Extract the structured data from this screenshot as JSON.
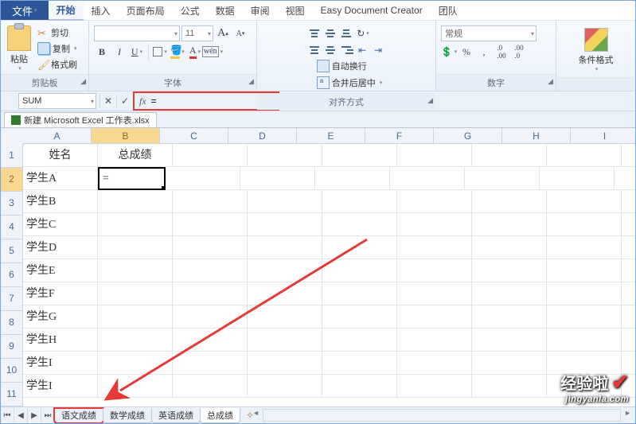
{
  "menu": {
    "file": "文件",
    "items": [
      "开始",
      "插入",
      "页面布局",
      "公式",
      "数据",
      "审阅",
      "视图",
      "Easy Document Creator",
      "团队"
    ],
    "active_index": 0
  },
  "ribbon": {
    "clipboard": {
      "label": "剪贴板",
      "paste": "粘贴",
      "cut": "剪切",
      "copy": "复制",
      "format_painter": "格式刷"
    },
    "font": {
      "label": "字体",
      "font_name_placeholder": "",
      "size": "11",
      "bold": "B",
      "italic": "I",
      "underline": "U",
      "phonetic": "wén"
    },
    "alignment": {
      "label": "对齐方式",
      "wrap": "自动换行",
      "merge": "合并后居中"
    },
    "number": {
      "label": "数字",
      "format": "常规",
      "currency": "¥",
      "percent": "%",
      "comma": ",",
      "dec_inc": ".00→.0",
      "dec_dec": ".0→.00"
    },
    "cond_format": "条件格式"
  },
  "formula_bar": {
    "name_box": "SUM",
    "cancel": "✕",
    "enter": "✓",
    "fx": "fx",
    "formula": "="
  },
  "workbook_tab": "新建 Microsoft Excel 工作表.xlsx",
  "grid": {
    "columns": [
      "A",
      "B",
      "C",
      "D",
      "E",
      "F",
      "G",
      "H",
      "I"
    ],
    "active_col_index": 1,
    "active_row_index": 1,
    "rows": [
      {
        "n": "1",
        "cells": [
          "姓名",
          "总成绩",
          "",
          "",
          "",
          "",
          "",
          "",
          ""
        ]
      },
      {
        "n": "2",
        "cells": [
          "学生A",
          "=",
          "",
          "",
          "",
          "",
          "",
          "",
          ""
        ]
      },
      {
        "n": "3",
        "cells": [
          "学生B",
          "",
          "",
          "",
          "",
          "",
          "",
          "",
          ""
        ]
      },
      {
        "n": "4",
        "cells": [
          "学生C",
          "",
          "",
          "",
          "",
          "",
          "",
          "",
          ""
        ]
      },
      {
        "n": "5",
        "cells": [
          "学生D",
          "",
          "",
          "",
          "",
          "",
          "",
          "",
          ""
        ]
      },
      {
        "n": "6",
        "cells": [
          "学生E",
          "",
          "",
          "",
          "",
          "",
          "",
          "",
          ""
        ]
      },
      {
        "n": "7",
        "cells": [
          "学生F",
          "",
          "",
          "",
          "",
          "",
          "",
          "",
          ""
        ]
      },
      {
        "n": "8",
        "cells": [
          "学生G",
          "",
          "",
          "",
          "",
          "",
          "",
          "",
          ""
        ]
      },
      {
        "n": "9",
        "cells": [
          "学生H",
          "",
          "",
          "",
          "",
          "",
          "",
          "",
          ""
        ]
      },
      {
        "n": "10",
        "cells": [
          "学生I",
          "",
          "",
          "",
          "",
          "",
          "",
          "",
          ""
        ]
      },
      {
        "n": "11",
        "cells": [
          "学生I",
          "",
          "",
          "",
          "",
          "",
          "",
          "",
          ""
        ]
      }
    ]
  },
  "sheet_tabs": {
    "tabs": [
      "语文成绩",
      "数学成绩",
      "英语成绩",
      "总成绩"
    ],
    "active_index": 3,
    "highlight_index": 0
  },
  "watermark": {
    "line1": "经验啦",
    "check": "✔",
    "line2": "jingyanla.com"
  }
}
